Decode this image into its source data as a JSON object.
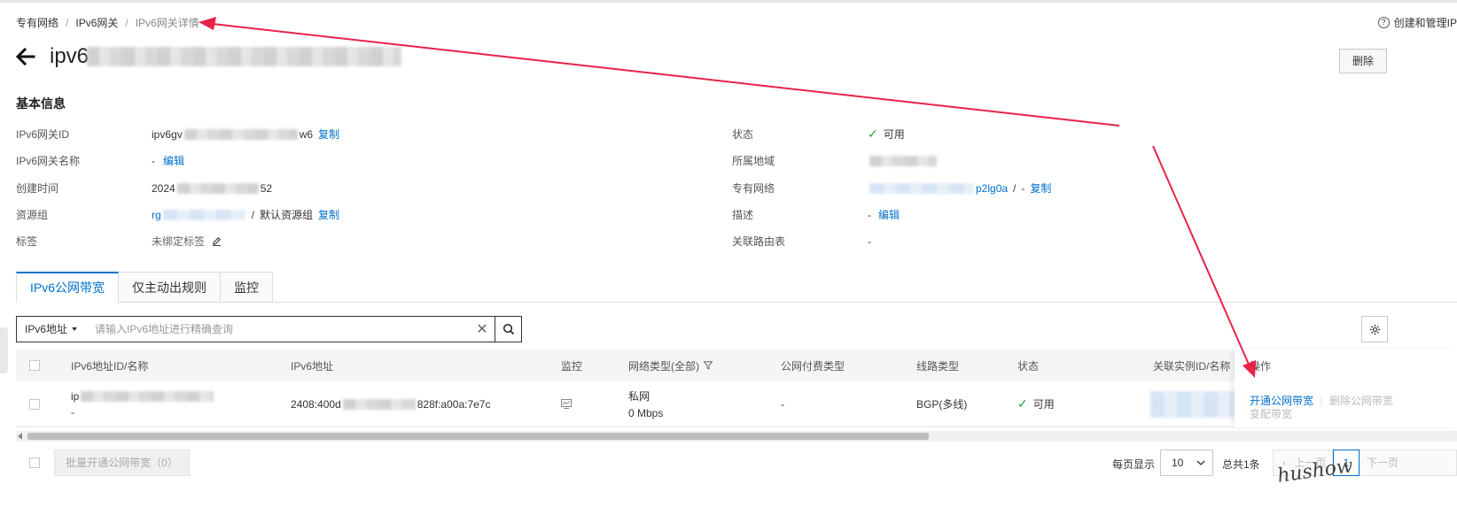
{
  "breadcrumb": {
    "item1": "专有网络",
    "item2": "IPv6网关",
    "current": "IPv6网关详情",
    "separator": "/"
  },
  "help": {
    "label": "创建和管理IP"
  },
  "title": {
    "prefix": "ipv6",
    "delete_label": "删除"
  },
  "basic_info": {
    "section_title": "基本信息",
    "gateway_id": {
      "label": "IPv6网关ID",
      "value_start": "ipv6gv",
      "value_end": "w6",
      "copy": "复制"
    },
    "gateway_name": {
      "label": "IPv6网关名称",
      "value": "-",
      "edit": "编辑"
    },
    "created": {
      "label": "创建时间",
      "value_start": "2024",
      "value_end": "52"
    },
    "resource_group": {
      "label": "资源组",
      "value_start": "rg",
      "value_end": "",
      "separator": "/",
      "default": "默认资源组",
      "copy": "复制"
    },
    "tags": {
      "label": "标签",
      "value": "未绑定标签"
    },
    "status": {
      "label": "状态",
      "value": "可用"
    },
    "region": {
      "label": "所属地域"
    },
    "vpc": {
      "label": "专有网络",
      "value_end": "p2lg0a",
      "separator": "/",
      "dash": "-",
      "copy": "复制"
    },
    "description": {
      "label": "描述",
      "value": "-",
      "edit": "编辑"
    },
    "route_table": {
      "label": "关联路由表",
      "value": "-"
    }
  },
  "tabs": [
    {
      "label": "IPv6公网带宽"
    },
    {
      "label": "仅主动出规则"
    },
    {
      "label": "监控"
    }
  ],
  "search": {
    "type_label": "IPv6地址",
    "placeholder": "请输入IPv6地址进行精确查询"
  },
  "table": {
    "headers": {
      "id_name": "IPv6地址ID/名称",
      "address": "IPv6地址",
      "monitor": "监控",
      "network_type": "网络类型(全部)",
      "billing": "公网付费类型",
      "line": "线路类型",
      "status": "状态",
      "instance": "关联实例ID/名称",
      "ops": "操作"
    },
    "row": {
      "id_prefix": "ip",
      "name": "-",
      "address_start": "2408:400d",
      "address_end": "828f:a00a:7e7c",
      "network_type": "私网",
      "bandwidth": "0 Mbps",
      "billing": "-",
      "line": "BGP(多线)",
      "status": "可用",
      "op_open": "开通公网带宽",
      "op_sep": "|",
      "op_delete": "删除公网带宽",
      "op_change": "变配带宽"
    }
  },
  "footer": {
    "batch_label": "批量开通公网带宽（0）",
    "per_page_label": "每页显示",
    "per_page_value": "10",
    "total": "总共1条",
    "prev": "上一页",
    "page": "1",
    "next": "下一页"
  },
  "watermark": "hushow",
  "colors": {
    "link": "#0070cc",
    "success": "#1e9e3e",
    "annotation": "#e8224a"
  }
}
